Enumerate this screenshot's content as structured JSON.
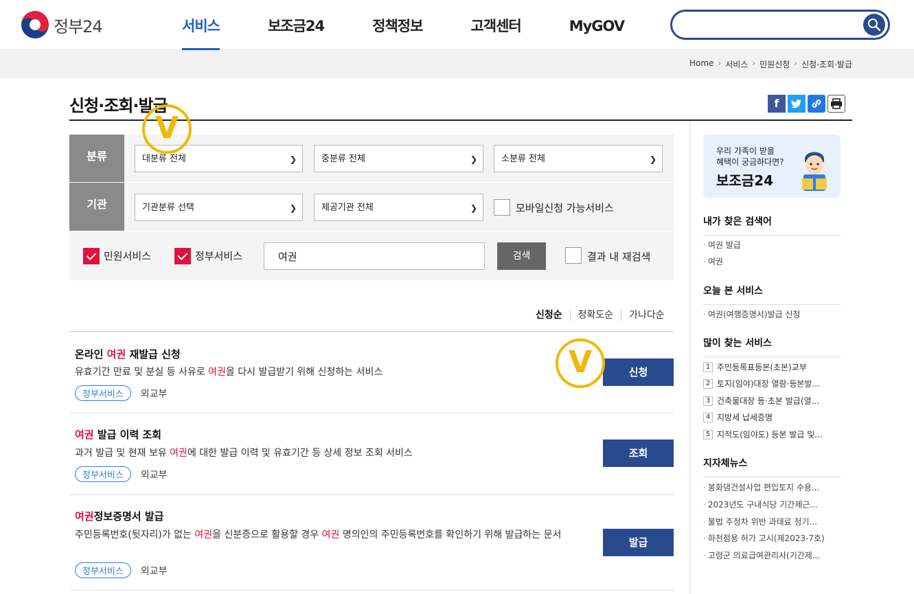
{
  "header": {
    "logo_text": "정부24",
    "nav": [
      {
        "label": "서비스",
        "active": true
      },
      {
        "label": "보조금24",
        "active": false
      },
      {
        "label": "정책정보",
        "active": false
      },
      {
        "label": "고객센터",
        "active": false
      },
      {
        "label": "MyGOV",
        "active": false
      }
    ],
    "search_placeholder": "",
    "search_icon": "search-icon"
  },
  "breadcrumb": [
    "Home",
    "서비스",
    "민원신청",
    "신청·조회·발급"
  ],
  "page": {
    "title": "신청·조회·발급",
    "share": {
      "facebook": "f",
      "twitter": "t",
      "link": "link-icon",
      "print": "print-icon"
    }
  },
  "filter": {
    "category_label": "분류",
    "agency_label": "기관",
    "category_selects": [
      "대분류 전체",
      "중분류 전체",
      "소분류 전체"
    ],
    "agency_selects": [
      "기관분류 선택",
      "제공기관 전체"
    ],
    "mobile_checkbox": "모바일신청 가능서비스",
    "civil_service": {
      "label": "민원서비스",
      "checked": true
    },
    "gov_service": {
      "label": "정부서비스",
      "checked": true
    },
    "keyword": "여권",
    "search_button": "검색",
    "research": {
      "label": "결과 내 재검색",
      "checked": false
    }
  },
  "sort": [
    "신청순",
    "정확도순",
    "가나다순"
  ],
  "results": [
    {
      "title_pre": "온라인 ",
      "title_hl": "여권",
      "title_post": " 재발급 신청",
      "desc_pre": "유효기간 만료 및 분실 등 사유로 ",
      "desc_hl": "여권",
      "desc_post": "을 다시 발급받기 위해 신청하는 서비스",
      "tag": "정부서비스",
      "org": "외교부",
      "button": "신청"
    },
    {
      "title_pre": "",
      "title_hl": "여권",
      "title_post": " 발급 이력 조회",
      "desc_pre": "과거 발급 및 현재 보유 ",
      "desc_hl": "여권",
      "desc_post": "에 대한 발급 이력 및 유효기간 등 상세 정보 조회 서비스",
      "tag": "정부서비스",
      "org": "외교부",
      "button": "조회"
    },
    {
      "title_pre": "",
      "title_hl": "여권",
      "title_post": "정보증명서 발급",
      "desc_pre": "주민등록번호(뒷자리)가 없는 ",
      "desc_hl": "여권",
      "desc_mid": "을 신분증으로 활용할 경우 ",
      "desc_hl2": "여권",
      "desc_post": " 명의인의 주민등록번호를 확인하기 위해 발급하는 문서",
      "tag": "정부서비스",
      "org": "외교부",
      "button": "발급"
    }
  ],
  "annotations": {
    "mark": "V",
    "color": "#f2b705"
  },
  "sidebar": {
    "banner_line1": "우리 가족이 받을",
    "banner_line2": "혜택이 궁금하다면?",
    "banner_title": "보조금24",
    "my_search_title": "내가 찾은 검색어",
    "my_search": [
      "여권 발급",
      "여권"
    ],
    "today_title": "오늘 본 서비스",
    "today": [
      "여권(여행증명서)발급 신청"
    ],
    "popular_title": "많이 찾는 서비스",
    "popular": [
      "주민등록표등본(초본)교부",
      "토지(임야)대장 열람·등본발...",
      "건축물대장 등·초본 발급(열...",
      "지방세 납세증명",
      "지적도(임야도) 등본 발급 및..."
    ],
    "news_title": "지자체뉴스",
    "news": [
      "봉화댐건설사업 편입토지 수용...",
      "2023년도 구내식당 기간제근...",
      "불법 주정차 위반 과태료 정기...",
      "하천점용 허가 고시(제2023-7호)",
      "고령군 의료급여관리사(기간제..."
    ]
  },
  "colors": {
    "primary": "#1f5fbf",
    "navy": "#2a4a8e",
    "accent": "#e4103f",
    "label_gray": "#8a8a8a"
  }
}
